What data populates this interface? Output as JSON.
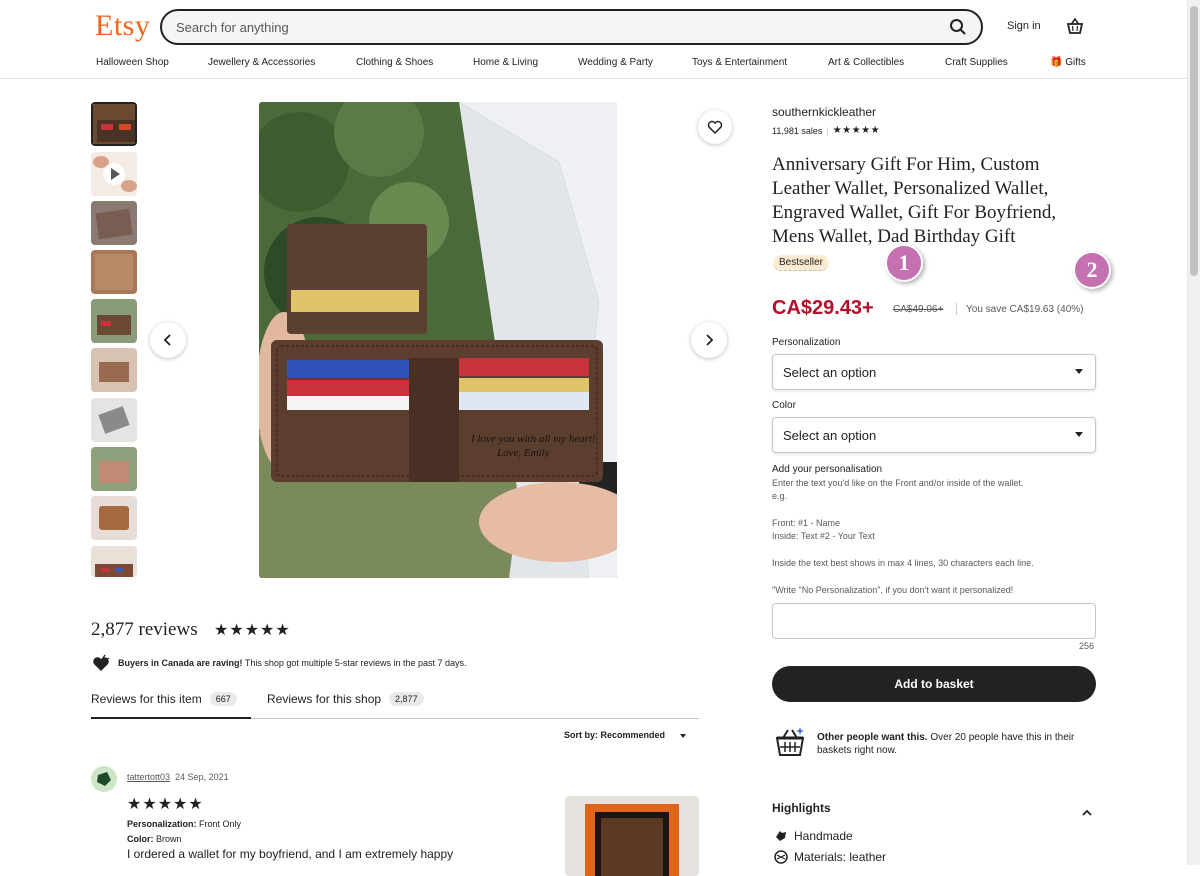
{
  "header": {
    "logo": "Etsy",
    "search_placeholder": "Search for anything",
    "signin_label": "Sign in"
  },
  "nav": {
    "items": [
      "Halloween Shop",
      "Jewellery & Accessories",
      "Clothing & Shoes",
      "Home & Living",
      "Wedding & Party",
      "Toys & Entertainment",
      "Art & Collectibles",
      "Craft Supplies",
      "Gifts"
    ]
  },
  "product": {
    "shop_name": "southernkickleather",
    "sales": "11,981 sales",
    "title": "Anniversary Gift For Him, Custom Leather Wallet, Personalized Wallet, Engraved Wallet, Gift For Boyfriend, Mens Wallet, Dad Birthday Gift",
    "badge": "Bestseller",
    "price": "CA$29.43+",
    "old_price": "CA$49.06+",
    "saving": "You save CA$19.63 (40%)",
    "personalization_label": "Personalization",
    "personalization_value": "Select an option",
    "color_label": "Color",
    "color_value": "Select an option",
    "add_personalisation_title": "Add your personalisation",
    "instructions": [
      "Enter the text you'd like on the Front and/or inside of the wallet.",
      "e.g.",
      "Front: #1 - Name",
      "Inside: Text #2 - Your Text",
      "Inside the text best shows in max 4 lines, 30 characters each line.",
      "\"Write \"No Personalization\", if you don't want it personalized!"
    ],
    "char_counter": "256",
    "add_to_basket": "Add to basket",
    "other_people_bold": "Other people want this.",
    "other_people_text": "Over 20 people have this in their baskets right now.",
    "highlights_title": "Highlights",
    "highlights": [
      "Handmade",
      "Materials: leather"
    ]
  },
  "markers": [
    "1",
    "2"
  ],
  "reviews": {
    "count_text": "2,877 reviews",
    "raving_bold": "Buyers in Canada are raving!",
    "raving_text": "This shop got multiple 5-star reviews in the past 7 days.",
    "tab_item": "Reviews for this item",
    "tab_item_count": "667",
    "tab_shop": "Reviews for this shop",
    "tab_shop_count": "2,877",
    "sort_label": "Sort by: Recommended",
    "first": {
      "reviewer": "tattertott03",
      "date": "24 Sep, 2021",
      "personalization_label": "Personalization:",
      "personalization_value": "Front Only",
      "color_label": "Color:",
      "color_value": "Brown",
      "text": "I ordered a wallet for my boyfriend, and I am extremely happy"
    }
  },
  "colors": {
    "brand": "#f1641e",
    "price": "#b3102a",
    "marker": "#c470b1"
  }
}
